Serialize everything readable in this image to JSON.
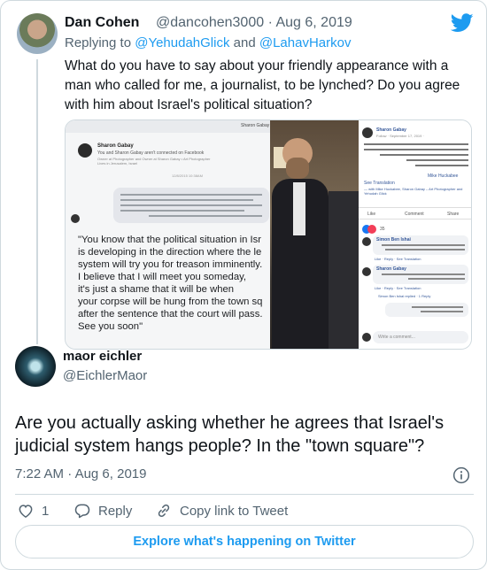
{
  "parent_tweet": {
    "author_name": "Dan Cohen",
    "author_handle": "@dancohen3000",
    "separator": "·",
    "date": "Aug 6, 2019",
    "replying_prefix": "Replying to",
    "reply_handle_1": "@YehudahGlick",
    "reply_and": "and",
    "reply_handle_2": "@LahavHarkov",
    "text": "What do you have to say about your friendly appearance with a man who called for me, a journalist, to be lynched? Do you agree with him about Israel's political situation?"
  },
  "media": {
    "left_header_name": "Sharon Gabay",
    "left_profile_name": "Sharon Gabay",
    "left_not_connected": "You and Sharon Gabay aren't connected on Facebook",
    "left_profile_info": "Owner at Photographer and Owner at Sharon Gabay • Art Photographer",
    "left_lives": "Lives in Jerusalem, Israel",
    "left_date": "12/8/2015 10:38AM",
    "quote_lines": "\"You know that the political situation in Isr\nis developing in the direction where the le\nsystem will try you for treason imminently.\nI believe that I will meet you someday,\nit's just a shame that it will be when\nyour corpse will be hung from the town sq\nafter the sentence that the court will pass.\nSee you soon\"",
    "right_name": "Sharon Gabay",
    "right_follow": "Follow · September 17, 2019 ·",
    "right_translation": "See Translation",
    "right_with": "— with Mike Huckabee, Sharon Gabay – Art Photographer and Yehudah Glick",
    "right_mike": "Mike Huckabee",
    "right_like": "Like",
    "right_comment": "Comment",
    "right_share": "Share",
    "right_reaction_count": "35",
    "right_commenter_1": "Simon Ben Ishai",
    "right_commenter_2": "Sharon Gabay",
    "right_reply_meta": "Like · Reply · See Translation",
    "right_replied": "Simon Ben Ishai replied · 1 Reply",
    "right_write": "Write a comment..."
  },
  "quote_tweet": {
    "author_name": "maor eichler",
    "author_handle": "@EichlerMaor",
    "text": "Are you actually asking whether he agrees that Israel's judicial system hangs people? In the \"town square\"?",
    "time": "7:22 AM",
    "separator": "·",
    "date": "Aug 6, 2019"
  },
  "actions": {
    "like_count": "1",
    "reply_label": "Reply",
    "copy_label": "Copy link to Tweet"
  },
  "footer": {
    "explore_label": "Explore what's happening on Twitter"
  },
  "colors": {
    "brand_blue": "#1d9bf0",
    "text_primary": "#0f1419",
    "text_secondary": "#536471",
    "border": "#cfd9de"
  },
  "icons": [
    "twitter-bird-icon",
    "info-icon",
    "heart-icon",
    "reply-bubble-icon",
    "link-icon"
  ]
}
